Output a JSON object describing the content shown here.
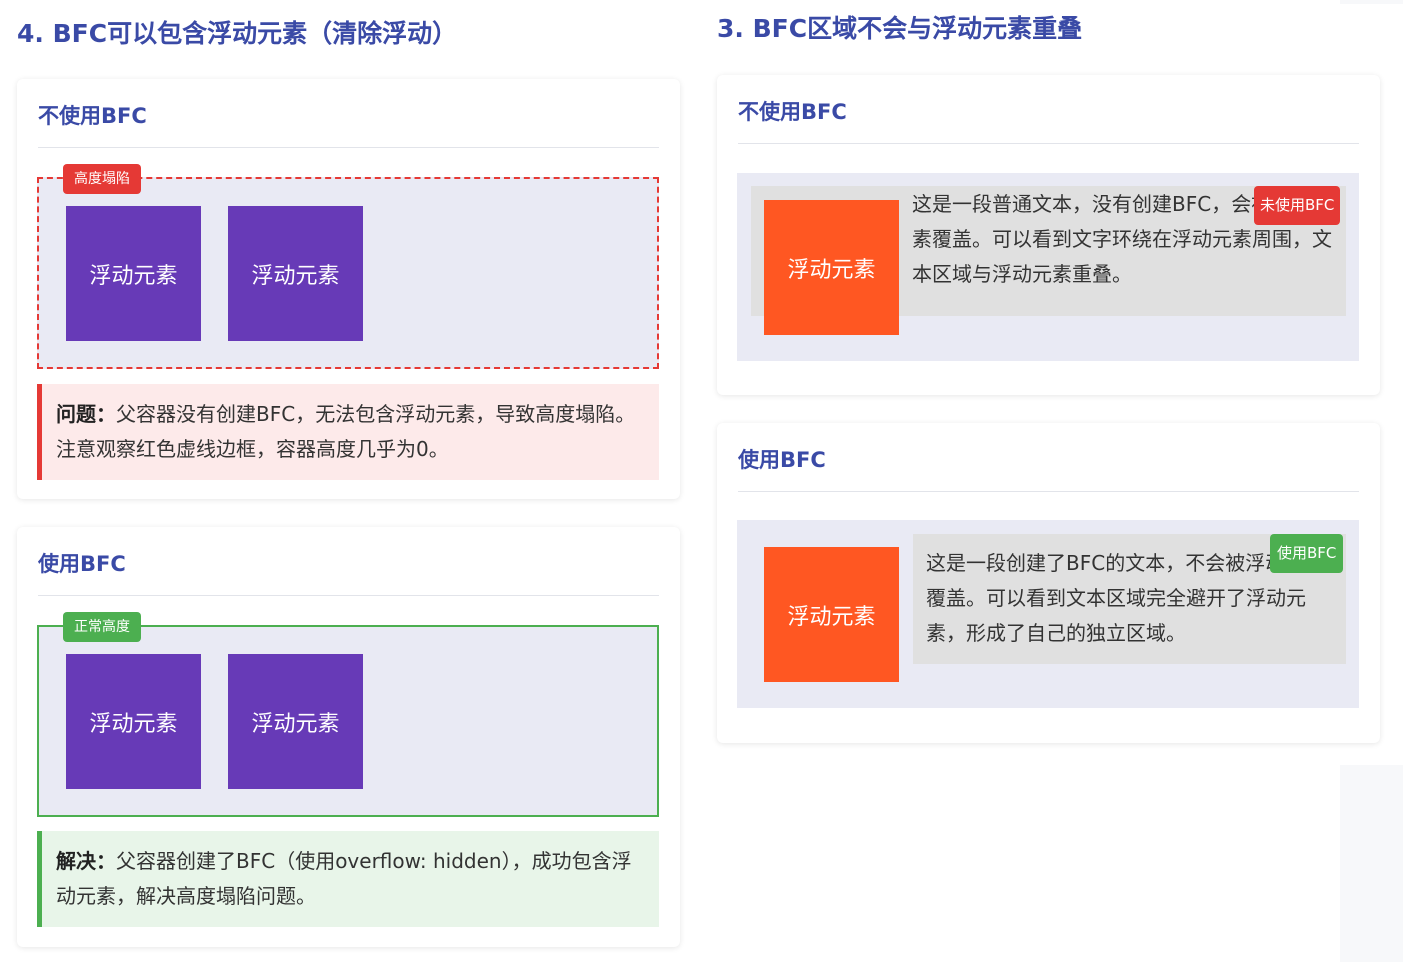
{
  "left_section": {
    "title": "4. BFC可以包含浮动元素（清除浮动）",
    "no_bfc_card": {
      "title": "不使用BFC",
      "tag": "高度塌陷",
      "float_label_1": "浮动元素",
      "float_label_2": "浮动元素",
      "note_label": "问题：",
      "note_text": "父容器没有创建BFC，无法包含浮动元素，导致高度塌陷。注意观察红色虚线边框，容器高度几乎为0。"
    },
    "bfc_card": {
      "title": "使用BFC",
      "tag": "正常高度",
      "float_label_1": "浮动元素",
      "float_label_2": "浮动元素",
      "note_label": "解决：",
      "note_text": "父容器创建了BFC（使用overflow: hidden），成功包含浮动元素，解决高度塌陷问题。"
    }
  },
  "right_section": {
    "title": "3. BFC区域不会与浮动元素重叠",
    "no_bfc_card": {
      "title": "不使用BFC",
      "float_label": "浮动元素",
      "text": "这是一段普通文本，没有创建BFC，会被浮动元素覆盖。可以看到文字环绕在浮动元素周围，文本区域与浮动元素重叠。",
      "tag": "未使用BFC"
    },
    "bfc_card": {
      "title": "使用BFC",
      "float_label": "浮动元素",
      "text": "这是一段创建了BFC的文本，不会被浮动元素覆盖。可以看到文本区域完全避开了浮动元素，形成了自己的独立区域。",
      "tag": "使用BFC"
    }
  },
  "colors": {
    "title_blue": "#3a4aa6",
    "float_purple": "#673ab7",
    "float_orange": "#ff5722",
    "danger_red": "#e53935",
    "success_green": "#4caf50",
    "container_bg": "#e9eaf4"
  }
}
